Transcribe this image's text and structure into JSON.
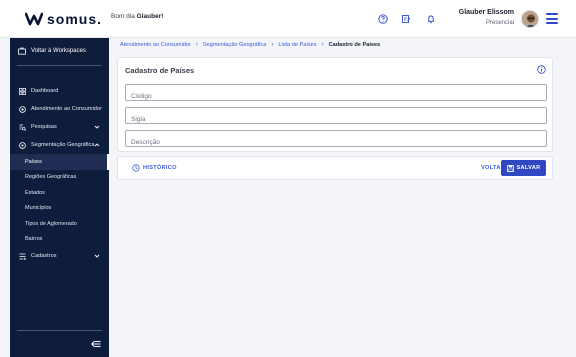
{
  "header": {
    "brand": "somus",
    "greeting_prefix": "Bom dia",
    "greeting_name": "Glauber!",
    "user_name": "Glauber Elissom",
    "user_role": "Presencial"
  },
  "sidebar": {
    "workspace_label": "Voltar à Workspaces",
    "items": [
      {
        "label": "Dashboard",
        "icon": "dashboard-icon"
      },
      {
        "label": "Atendimento ao Consumidor",
        "icon": "support-icon"
      },
      {
        "label": "Pesquisas",
        "icon": "search-icon",
        "expandable": true,
        "expanded": false
      },
      {
        "label": "Segmentação Geográfica",
        "icon": "location-icon",
        "expandable": true,
        "expanded": true
      },
      {
        "label": "Cadastros",
        "icon": "list-icon",
        "expandable": true,
        "expanded": false
      }
    ],
    "sub_items": [
      {
        "label": "Países",
        "active": true
      },
      {
        "label": "Regiões Geográficas"
      },
      {
        "label": "Estados"
      },
      {
        "label": "Municípios"
      },
      {
        "label": "Tipos de Aglomerado"
      },
      {
        "label": "Bairros"
      }
    ]
  },
  "breadcrumb": [
    "Atendimento ao Consumidor",
    "Segmentação Geográfica",
    "Lista de Países",
    "Cadastro de Países"
  ],
  "form": {
    "title": "Cadastro de Países",
    "fields": [
      {
        "placeholder": "Código",
        "value": ""
      },
      {
        "placeholder": "Sigla",
        "value": ""
      },
      {
        "placeholder": "Descrição",
        "value": ""
      }
    ]
  },
  "actions": {
    "history_label": "HISTÓRICO",
    "back_label": "VOLTAR",
    "save_label": "SALVAR"
  },
  "colors": {
    "primary": "#2f47c2",
    "sidebar_bg": "#0f1d3d",
    "link": "#3f5bd8",
    "background": "#f4f5f8"
  }
}
